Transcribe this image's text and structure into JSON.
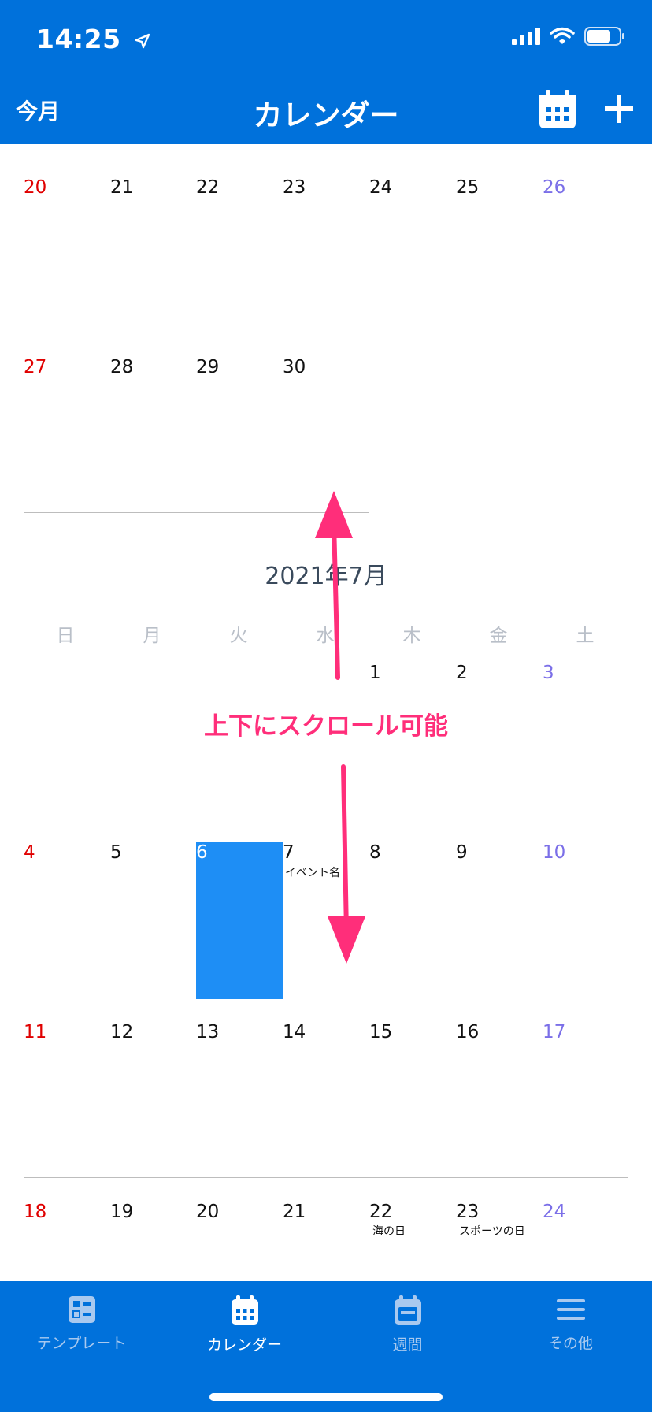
{
  "status": {
    "time": "14:25"
  },
  "nav": {
    "today_label": "今月",
    "title": "カレンダー"
  },
  "calendar": {
    "month_title": "2021年7月",
    "weekdays": [
      "日",
      "月",
      "火",
      "水",
      "木",
      "金",
      "土"
    ],
    "prev_week1": [
      "20",
      "21",
      "22",
      "23",
      "24",
      "25",
      "26"
    ],
    "prev_week2": [
      "27",
      "28",
      "29",
      "30"
    ],
    "week1": [
      "1",
      "2",
      "3"
    ],
    "week2": [
      "4",
      "5",
      "6",
      "7",
      "8",
      "9",
      "10"
    ],
    "week3": [
      "11",
      "12",
      "13",
      "14",
      "15",
      "16",
      "17"
    ],
    "week4": [
      "18",
      "19",
      "20",
      "21",
      "22",
      "23",
      "24"
    ],
    "events": {
      "jul7": "イベント名",
      "jul22": "海の日",
      "jul23": "スポーツの日"
    },
    "selected_day": "6"
  },
  "annotation": "上下にスクロール可能",
  "tabs": [
    {
      "label": "テンプレート",
      "icon": "template-icon"
    },
    {
      "label": "カレンダー",
      "icon": "calendar-icon"
    },
    {
      "label": "週間",
      "icon": "week-icon"
    },
    {
      "label": "その他",
      "icon": "menu-icon"
    }
  ],
  "colors": {
    "brand": "#0071DB",
    "selected": "#1E8EF5",
    "sunday": "#e00000",
    "saturday": "#7b6fe8",
    "annotation": "#ff2e7a"
  }
}
